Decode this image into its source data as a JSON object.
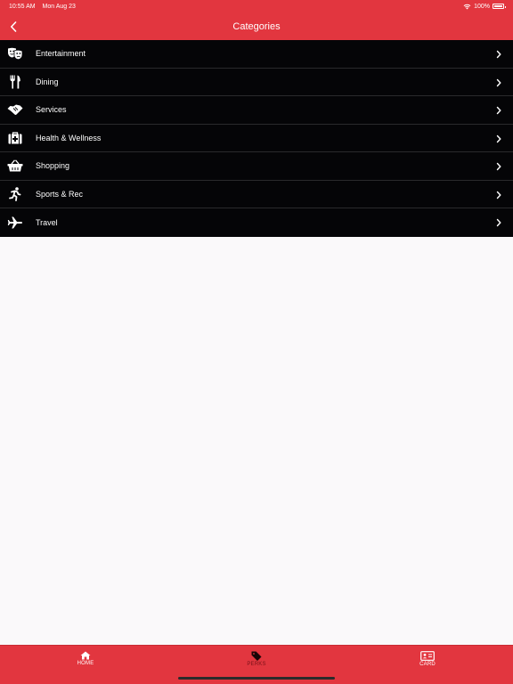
{
  "status_bar": {
    "time": "10:55 AM",
    "date": "Mon Aug 23",
    "battery": "100%"
  },
  "nav": {
    "title": "Categories",
    "back_icon": "chevron-left-icon"
  },
  "categories": [
    {
      "label": "Entertainment",
      "icon": "theater-masks-icon"
    },
    {
      "label": "Dining",
      "icon": "utensils-icon"
    },
    {
      "label": "Services",
      "icon": "handshake-icon"
    },
    {
      "label": "Health & Wellness",
      "icon": "first-aid-kit-icon"
    },
    {
      "label": "Shopping",
      "icon": "shopping-basket-icon"
    },
    {
      "label": "Sports & Rec",
      "icon": "running-person-icon"
    },
    {
      "label": "Travel",
      "icon": "airplane-icon"
    }
  ],
  "tabs": [
    {
      "label": "HOME",
      "icon": "home-icon",
      "active": false
    },
    {
      "label": "PERKS",
      "icon": "tag-icon",
      "active": true
    },
    {
      "label": "CARD",
      "icon": "id-card-icon",
      "active": false
    }
  ],
  "colors": {
    "brand_red": "#e2363f",
    "list_bg": "#050507",
    "content_bg": "#faf9fa",
    "active_tab": "#7a1218"
  }
}
